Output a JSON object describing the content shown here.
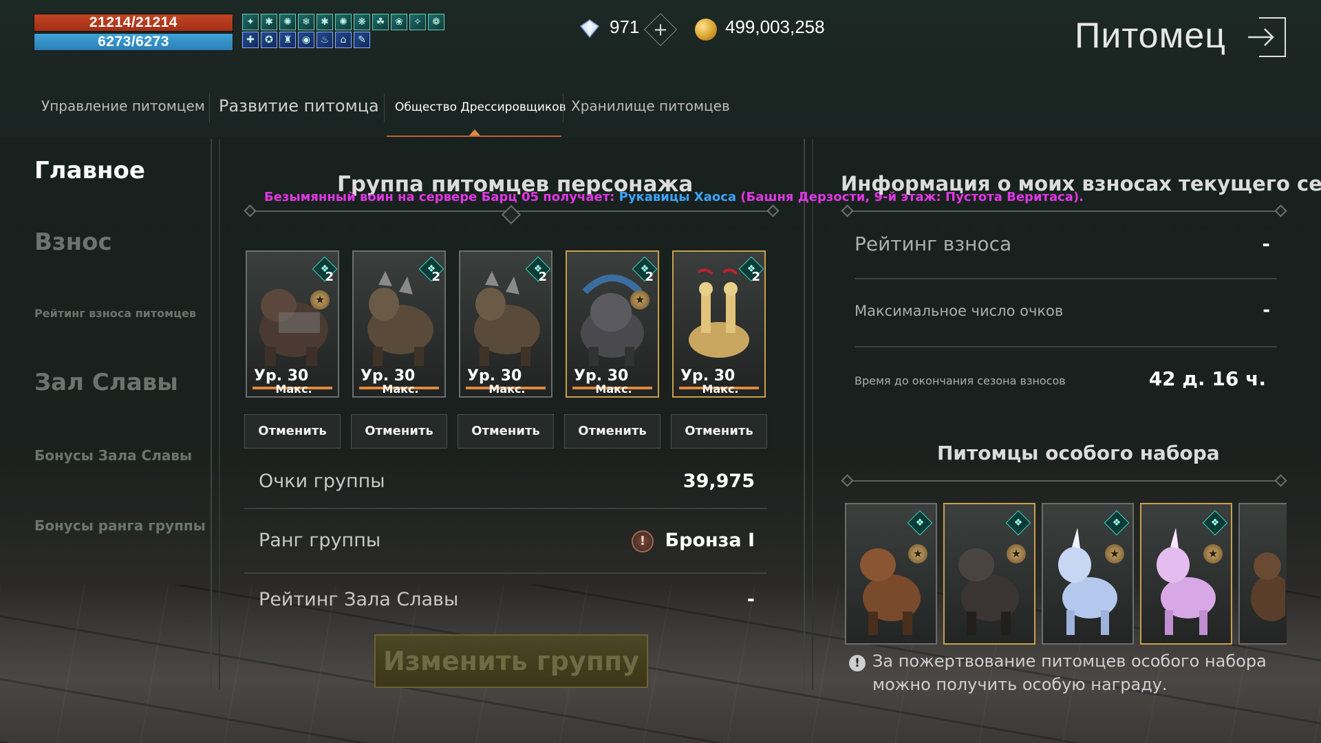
{
  "player": {
    "hp": "21214/21214",
    "mp": "6273/6273"
  },
  "currency": {
    "diamonds": "971",
    "gold": "499,003,258"
  },
  "page_title": "Питомец",
  "tabs": [
    {
      "label": "Управление питомцем"
    },
    {
      "label": "Развитие питомца"
    },
    {
      "label": "Общество Дрессировщиков"
    },
    {
      "label": "Хранилище питомцев"
    }
  ],
  "sidebar": {
    "main": "Главное",
    "contribution": "Взнос",
    "contribution_rating": "Рейтинг взноса питомцев",
    "hall_of_fame": "Зал Славы",
    "hall_bonuses": "Бонусы Зала Славы",
    "group_rank_bonuses": "Бонусы ранга группы"
  },
  "group": {
    "title": "Группа питомцев персонажа",
    "pets": [
      {
        "level": "Ур. 30",
        "max": "Макс.",
        "count": "2",
        "cancel": "Отменить"
      },
      {
        "level": "Ур. 30",
        "max": "Макс.",
        "count": "2",
        "cancel": "Отменить"
      },
      {
        "level": "Ур. 30",
        "max": "Макс.",
        "count": "2",
        "cancel": "Отменить"
      },
      {
        "level": "Ур. 30",
        "max": "Макс.",
        "count": "2",
        "cancel": "Отменить"
      },
      {
        "level": "Ур. 30",
        "max": "Макс.",
        "count": "2",
        "cancel": "Отменить"
      }
    ],
    "points_label": "Очки группы",
    "points_value": "39,975",
    "rank_label": "Ранг группы",
    "rank_value": "Бронза I",
    "hall_rating_label": "Рейтинг Зала Славы",
    "hall_rating_value": "-",
    "change_button": "Изменить группу"
  },
  "notice": {
    "prefix": "Безымянный воин на сервере Барц 05 получает: ",
    "item": "Рукавицы Хаоса",
    "suffix": " (Башня Дерзости, 9-й этаж: Пустота Веритаса)."
  },
  "season": {
    "title": "Информация о моих взносах текущего сезона",
    "rating_label": "Рейтинг взноса",
    "rating_value": "-",
    "max_points_label": "Максимальное число очков",
    "max_points_value": "-",
    "time_label": "Время до окончания сезона взносов",
    "time_value": "42 д. 16 ч."
  },
  "special": {
    "title": "Питомцы особого набора",
    "info": "За пожертвование питомцев особого набора можно получить особую награду."
  },
  "colors": {
    "hp": "#c34523",
    "mp": "#3fa3d8",
    "accent": "#e0883d",
    "gold_border": "#c9a14c",
    "notice_magenta": "#e236e6",
    "notice_item": "#3aa5ff"
  }
}
